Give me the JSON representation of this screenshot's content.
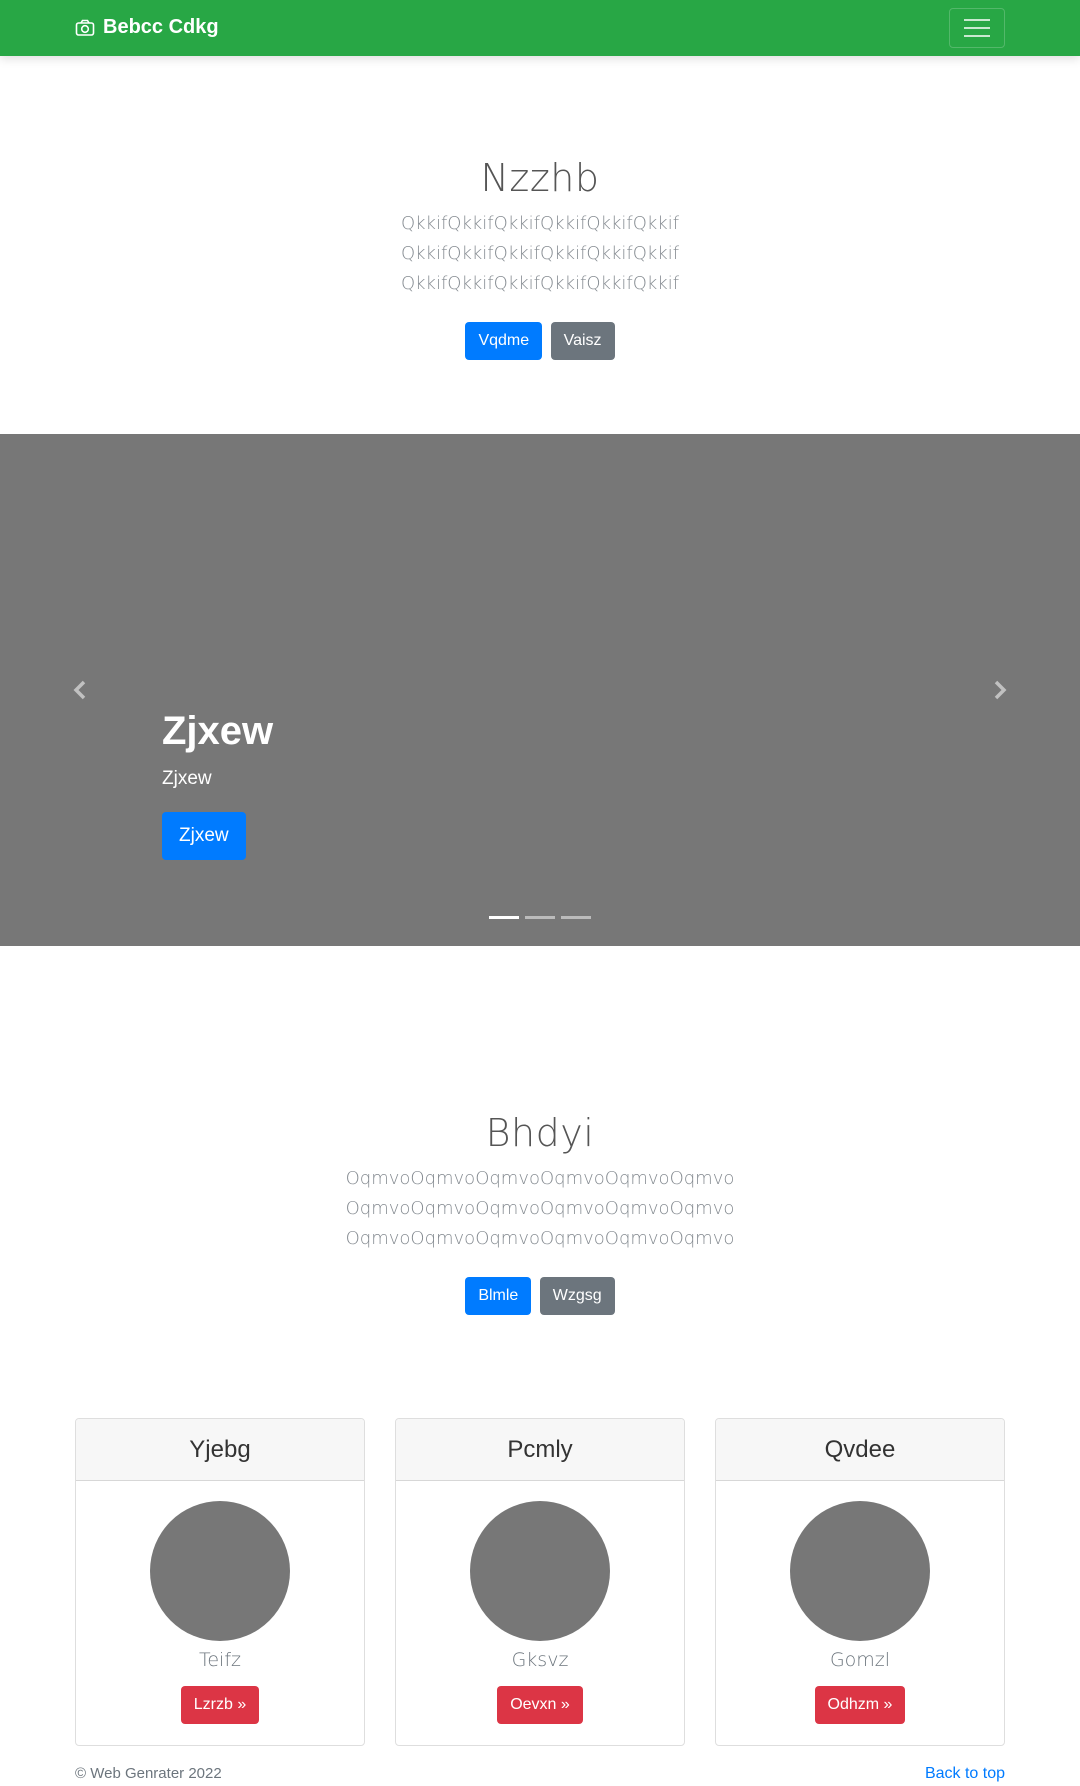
{
  "navbar": {
    "brand": "Bebcc Cdkg",
    "brand_icon": "camera-icon",
    "toggler_icon": "hamburger-icon",
    "color": "#28a745"
  },
  "hero": {
    "title": "Nzzhb",
    "text": "QkkifQkkifQkkifQkkifQkkifQkkif QkkifQkkifQkkifQkkifQkkifQkkif QkkifQkkifQkkifQkkifQkkifQkkif",
    "primary_button": "Vqdme",
    "secondary_button": "Vaisz"
  },
  "carousel": {
    "caption_title": "Zjxew",
    "caption_text": "Zjxew",
    "caption_button": "Zjxew",
    "prev_icon": "chevron-left-icon",
    "next_icon": "chevron-right-icon",
    "slide_count": 3,
    "active_index": 0
  },
  "section": {
    "title": "Bhdyi",
    "text": "OqmvoOqmvoOqmvoOqmvoOqmvoOqmvo OqmvoOqmvoOqmvoOqmvoOqmvoOqmvo OqmvoOqmvoOqmvoOqmvoOqmvoOqmvo",
    "primary_button": "Blmle",
    "secondary_button": "Wzgsg"
  },
  "cards": [
    {
      "header": "Yjebg",
      "name": "Teifz",
      "button": "Lzrzb »"
    },
    {
      "header": "Pcmly",
      "name": "Gksvz",
      "button": "Oevxn »"
    },
    {
      "header": "Qvdee",
      "name": "Gomzl",
      "button": "Odhzm »"
    }
  ],
  "footer": {
    "copyright": "© Web Genrater 2022",
    "back_to_top": "Back to top"
  }
}
